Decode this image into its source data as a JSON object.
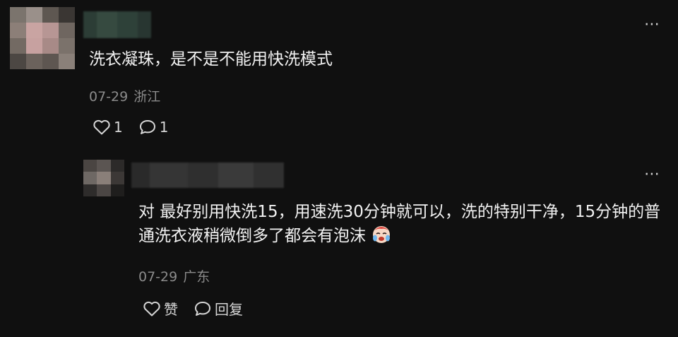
{
  "comment": {
    "text": "洗衣凝珠，是不是不能用快洗模式",
    "date": "07-29",
    "location": "浙江",
    "likes": "1",
    "replies": "1",
    "more_icon": "⋯"
  },
  "reply": {
    "text": "对 最好别用快洗15，用速洗30分钟就可以，洗的特别干净，15分钟的普通洗衣液稍微倒多了都会有泡沫",
    "emoji": "crying-face-emoji",
    "date": "07-29",
    "location": "广东",
    "like_label": "赞",
    "reply_label": "回复",
    "more_icon": "⋯"
  },
  "colors": {
    "background": "#101010",
    "text": "#f2f2f2",
    "meta": "#8b8b8b"
  }
}
